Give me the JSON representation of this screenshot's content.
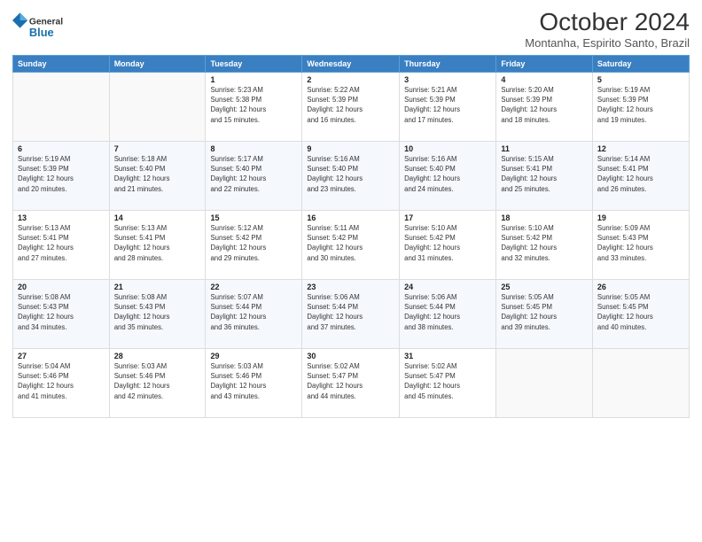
{
  "header": {
    "logo_line1": "General",
    "logo_line2": "Blue",
    "month": "October 2024",
    "location": "Montanha, Espirito Santo, Brazil"
  },
  "weekdays": [
    "Sunday",
    "Monday",
    "Tuesday",
    "Wednesday",
    "Thursday",
    "Friday",
    "Saturday"
  ],
  "weeks": [
    [
      {
        "day": "",
        "detail": ""
      },
      {
        "day": "",
        "detail": ""
      },
      {
        "day": "1",
        "detail": "Sunrise: 5:23 AM\nSunset: 5:38 PM\nDaylight: 12 hours\nand 15 minutes."
      },
      {
        "day": "2",
        "detail": "Sunrise: 5:22 AM\nSunset: 5:39 PM\nDaylight: 12 hours\nand 16 minutes."
      },
      {
        "day": "3",
        "detail": "Sunrise: 5:21 AM\nSunset: 5:39 PM\nDaylight: 12 hours\nand 17 minutes."
      },
      {
        "day": "4",
        "detail": "Sunrise: 5:20 AM\nSunset: 5:39 PM\nDaylight: 12 hours\nand 18 minutes."
      },
      {
        "day": "5",
        "detail": "Sunrise: 5:19 AM\nSunset: 5:39 PM\nDaylight: 12 hours\nand 19 minutes."
      }
    ],
    [
      {
        "day": "6",
        "detail": "Sunrise: 5:19 AM\nSunset: 5:39 PM\nDaylight: 12 hours\nand 20 minutes."
      },
      {
        "day": "7",
        "detail": "Sunrise: 5:18 AM\nSunset: 5:40 PM\nDaylight: 12 hours\nand 21 minutes."
      },
      {
        "day": "8",
        "detail": "Sunrise: 5:17 AM\nSunset: 5:40 PM\nDaylight: 12 hours\nand 22 minutes."
      },
      {
        "day": "9",
        "detail": "Sunrise: 5:16 AM\nSunset: 5:40 PM\nDaylight: 12 hours\nand 23 minutes."
      },
      {
        "day": "10",
        "detail": "Sunrise: 5:16 AM\nSunset: 5:40 PM\nDaylight: 12 hours\nand 24 minutes."
      },
      {
        "day": "11",
        "detail": "Sunrise: 5:15 AM\nSunset: 5:41 PM\nDaylight: 12 hours\nand 25 minutes."
      },
      {
        "day": "12",
        "detail": "Sunrise: 5:14 AM\nSunset: 5:41 PM\nDaylight: 12 hours\nand 26 minutes."
      }
    ],
    [
      {
        "day": "13",
        "detail": "Sunrise: 5:13 AM\nSunset: 5:41 PM\nDaylight: 12 hours\nand 27 minutes."
      },
      {
        "day": "14",
        "detail": "Sunrise: 5:13 AM\nSunset: 5:41 PM\nDaylight: 12 hours\nand 28 minutes."
      },
      {
        "day": "15",
        "detail": "Sunrise: 5:12 AM\nSunset: 5:42 PM\nDaylight: 12 hours\nand 29 minutes."
      },
      {
        "day": "16",
        "detail": "Sunrise: 5:11 AM\nSunset: 5:42 PM\nDaylight: 12 hours\nand 30 minutes."
      },
      {
        "day": "17",
        "detail": "Sunrise: 5:10 AM\nSunset: 5:42 PM\nDaylight: 12 hours\nand 31 minutes."
      },
      {
        "day": "18",
        "detail": "Sunrise: 5:10 AM\nSunset: 5:42 PM\nDaylight: 12 hours\nand 32 minutes."
      },
      {
        "day": "19",
        "detail": "Sunrise: 5:09 AM\nSunset: 5:43 PM\nDaylight: 12 hours\nand 33 minutes."
      }
    ],
    [
      {
        "day": "20",
        "detail": "Sunrise: 5:08 AM\nSunset: 5:43 PM\nDaylight: 12 hours\nand 34 minutes."
      },
      {
        "day": "21",
        "detail": "Sunrise: 5:08 AM\nSunset: 5:43 PM\nDaylight: 12 hours\nand 35 minutes."
      },
      {
        "day": "22",
        "detail": "Sunrise: 5:07 AM\nSunset: 5:44 PM\nDaylight: 12 hours\nand 36 minutes."
      },
      {
        "day": "23",
        "detail": "Sunrise: 5:06 AM\nSunset: 5:44 PM\nDaylight: 12 hours\nand 37 minutes."
      },
      {
        "day": "24",
        "detail": "Sunrise: 5:06 AM\nSunset: 5:44 PM\nDaylight: 12 hours\nand 38 minutes."
      },
      {
        "day": "25",
        "detail": "Sunrise: 5:05 AM\nSunset: 5:45 PM\nDaylight: 12 hours\nand 39 minutes."
      },
      {
        "day": "26",
        "detail": "Sunrise: 5:05 AM\nSunset: 5:45 PM\nDaylight: 12 hours\nand 40 minutes."
      }
    ],
    [
      {
        "day": "27",
        "detail": "Sunrise: 5:04 AM\nSunset: 5:46 PM\nDaylight: 12 hours\nand 41 minutes."
      },
      {
        "day": "28",
        "detail": "Sunrise: 5:03 AM\nSunset: 5:46 PM\nDaylight: 12 hours\nand 42 minutes."
      },
      {
        "day": "29",
        "detail": "Sunrise: 5:03 AM\nSunset: 5:46 PM\nDaylight: 12 hours\nand 43 minutes."
      },
      {
        "day": "30",
        "detail": "Sunrise: 5:02 AM\nSunset: 5:47 PM\nDaylight: 12 hours\nand 44 minutes."
      },
      {
        "day": "31",
        "detail": "Sunrise: 5:02 AM\nSunset: 5:47 PM\nDaylight: 12 hours\nand 45 minutes."
      },
      {
        "day": "",
        "detail": ""
      },
      {
        "day": "",
        "detail": ""
      }
    ]
  ]
}
